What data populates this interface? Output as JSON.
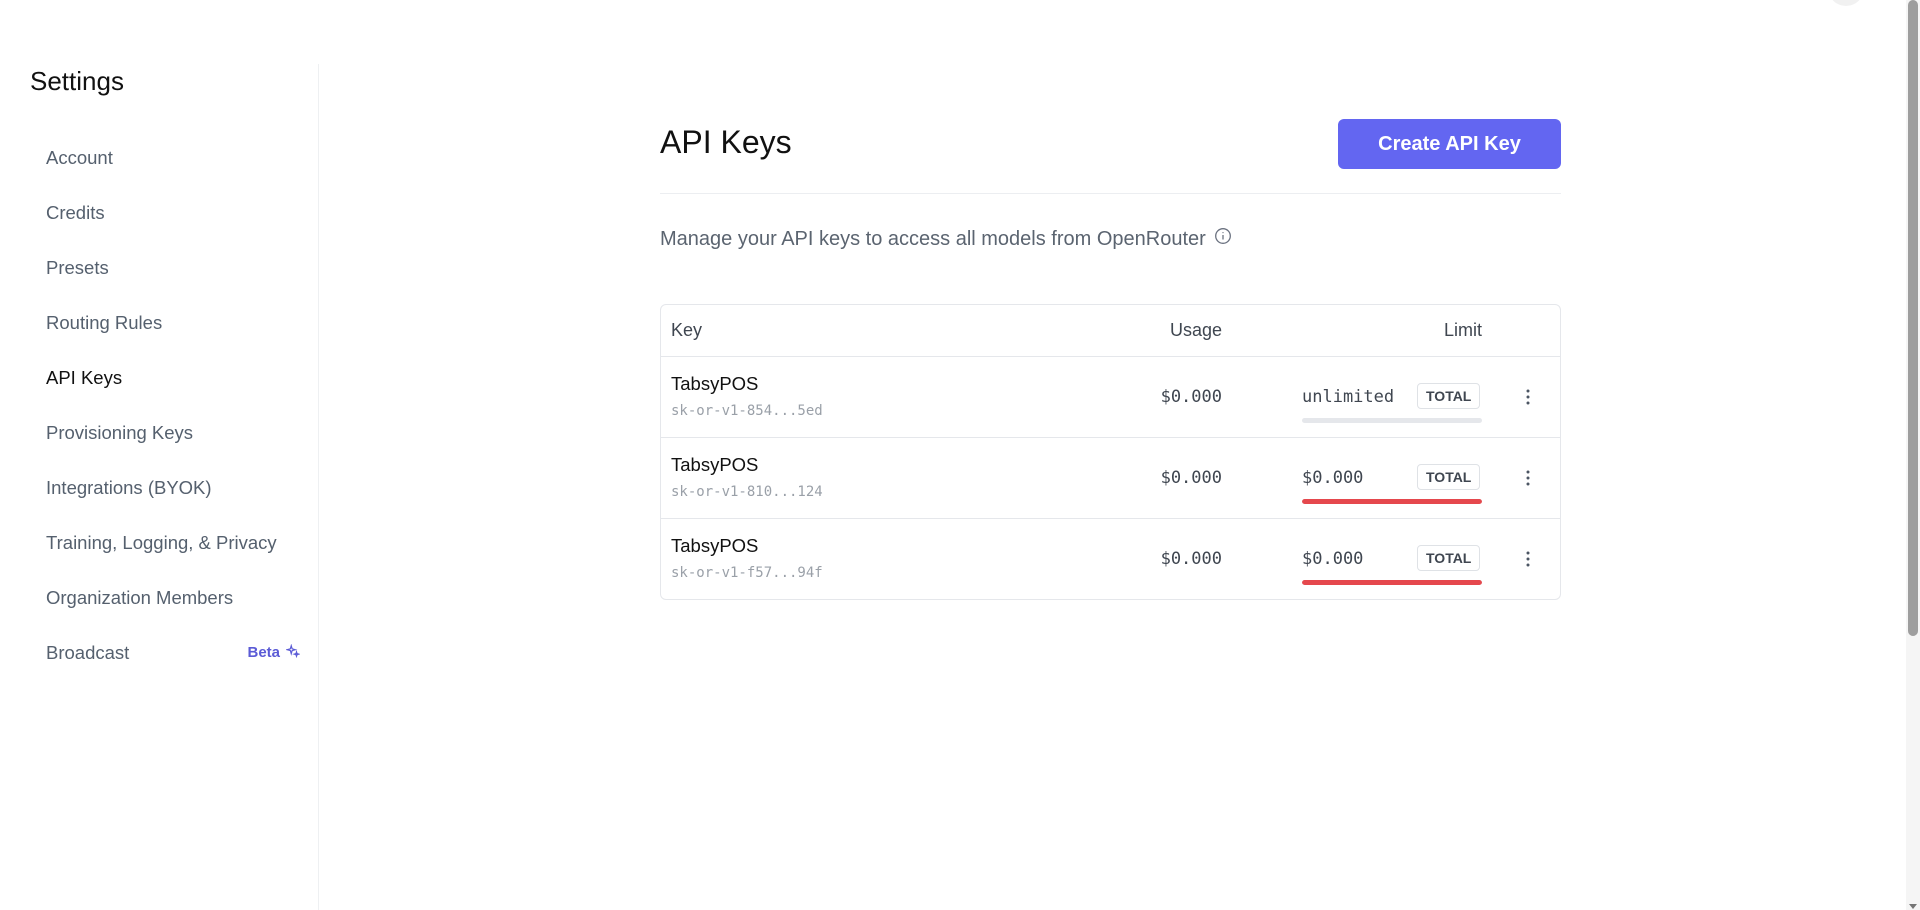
{
  "sidebar": {
    "title": "Settings",
    "items": [
      {
        "label": "Account"
      },
      {
        "label": "Credits"
      },
      {
        "label": "Presets"
      },
      {
        "label": "Routing Rules"
      },
      {
        "label": "API Keys",
        "active": true
      },
      {
        "label": "Provisioning Keys"
      },
      {
        "label": "Integrations (BYOK)"
      },
      {
        "label": "Training, Logging, & Privacy"
      },
      {
        "label": "Organization Members"
      },
      {
        "label": "Broadcast",
        "badge": "Beta",
        "badge_icon": "sparkle-icon"
      }
    ]
  },
  "main": {
    "title": "API Keys",
    "create_button": "Create API Key",
    "subtitle": "Manage your API keys to access all models from OpenRouter",
    "info_icon": "info-icon"
  },
  "table": {
    "columns": [
      "Key",
      "Usage",
      "Limit"
    ],
    "rows": [
      {
        "name": "TabsyPOS",
        "key": "sk-or-v1-854...5ed",
        "usage": "$0.000",
        "limit": "unlimited",
        "limit_type": "TOTAL",
        "bar_fill": 0,
        "bar_color": "#e5e7eb"
      },
      {
        "name": "TabsyPOS",
        "key": "sk-or-v1-810...124",
        "usage": "$0.000",
        "limit": "$0.000",
        "limit_type": "TOTAL",
        "bar_fill": 1.0,
        "bar_color": "#e5484d"
      },
      {
        "name": "TabsyPOS",
        "key": "sk-or-v1-f57...94f",
        "usage": "$0.000",
        "limit": "$0.000",
        "limit_type": "TOTAL",
        "bar_fill": 1.0,
        "bar_color": "#e5484d"
      }
    ]
  },
  "colors": {
    "accent": "#6366f1",
    "beta": "#5b5bd6",
    "danger": "#e5484d"
  }
}
